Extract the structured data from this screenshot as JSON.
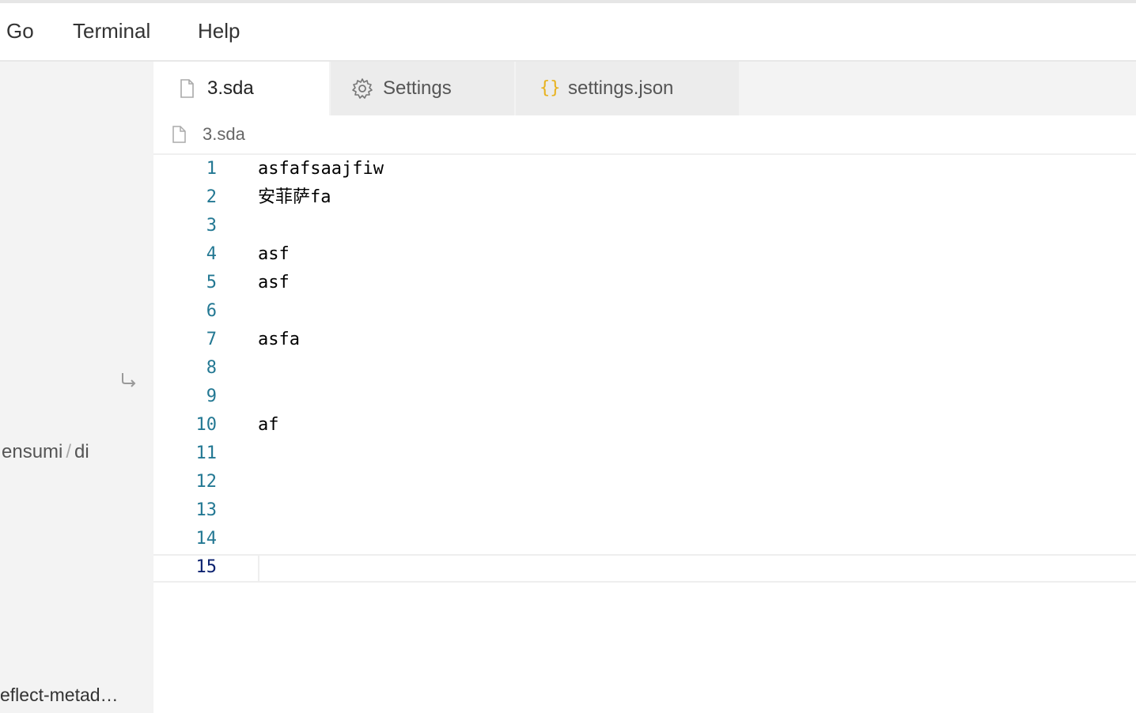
{
  "menu": {
    "items": [
      {
        "label": "Go"
      },
      {
        "label": "Terminal"
      },
      {
        "label": "Help"
      }
    ]
  },
  "sidebar": {
    "path_part1": "ensumi",
    "path_sep": "/",
    "path_part2": "di",
    "reflect_label": "eflect-metad…",
    "wrap_icon": "wrap-arrow-icon"
  },
  "tabs": [
    {
      "label": "3.sda",
      "icon": "file-icon",
      "active": true
    },
    {
      "label": "Settings",
      "icon": "gear-icon",
      "active": false
    },
    {
      "label": "settings.json",
      "icon": "braces-icon",
      "active": false
    }
  ],
  "breadcrumb": {
    "file": "3.sda",
    "icon": "file-icon"
  },
  "editor": {
    "current_line": 15,
    "lines": [
      {
        "num": "1",
        "text": "asfafsaajfiw"
      },
      {
        "num": "2",
        "text": "安菲萨fa"
      },
      {
        "num": "3",
        "text": ""
      },
      {
        "num": "4",
        "text": "asf"
      },
      {
        "num": "5",
        "text": "asf"
      },
      {
        "num": "6",
        "text": ""
      },
      {
        "num": "7",
        "text": "asfa"
      },
      {
        "num": "8",
        "text": ""
      },
      {
        "num": "9",
        "text": ""
      },
      {
        "num": "10",
        "text": "af"
      },
      {
        "num": "11",
        "text": ""
      },
      {
        "num": "12",
        "text": ""
      },
      {
        "num": "13",
        "text": ""
      },
      {
        "num": "14",
        "text": ""
      },
      {
        "num": "15",
        "text": ""
      }
    ]
  },
  "colors": {
    "line_number": "#237893",
    "active_line_number": "#0b216f",
    "braces_icon": "#e8b21d"
  }
}
